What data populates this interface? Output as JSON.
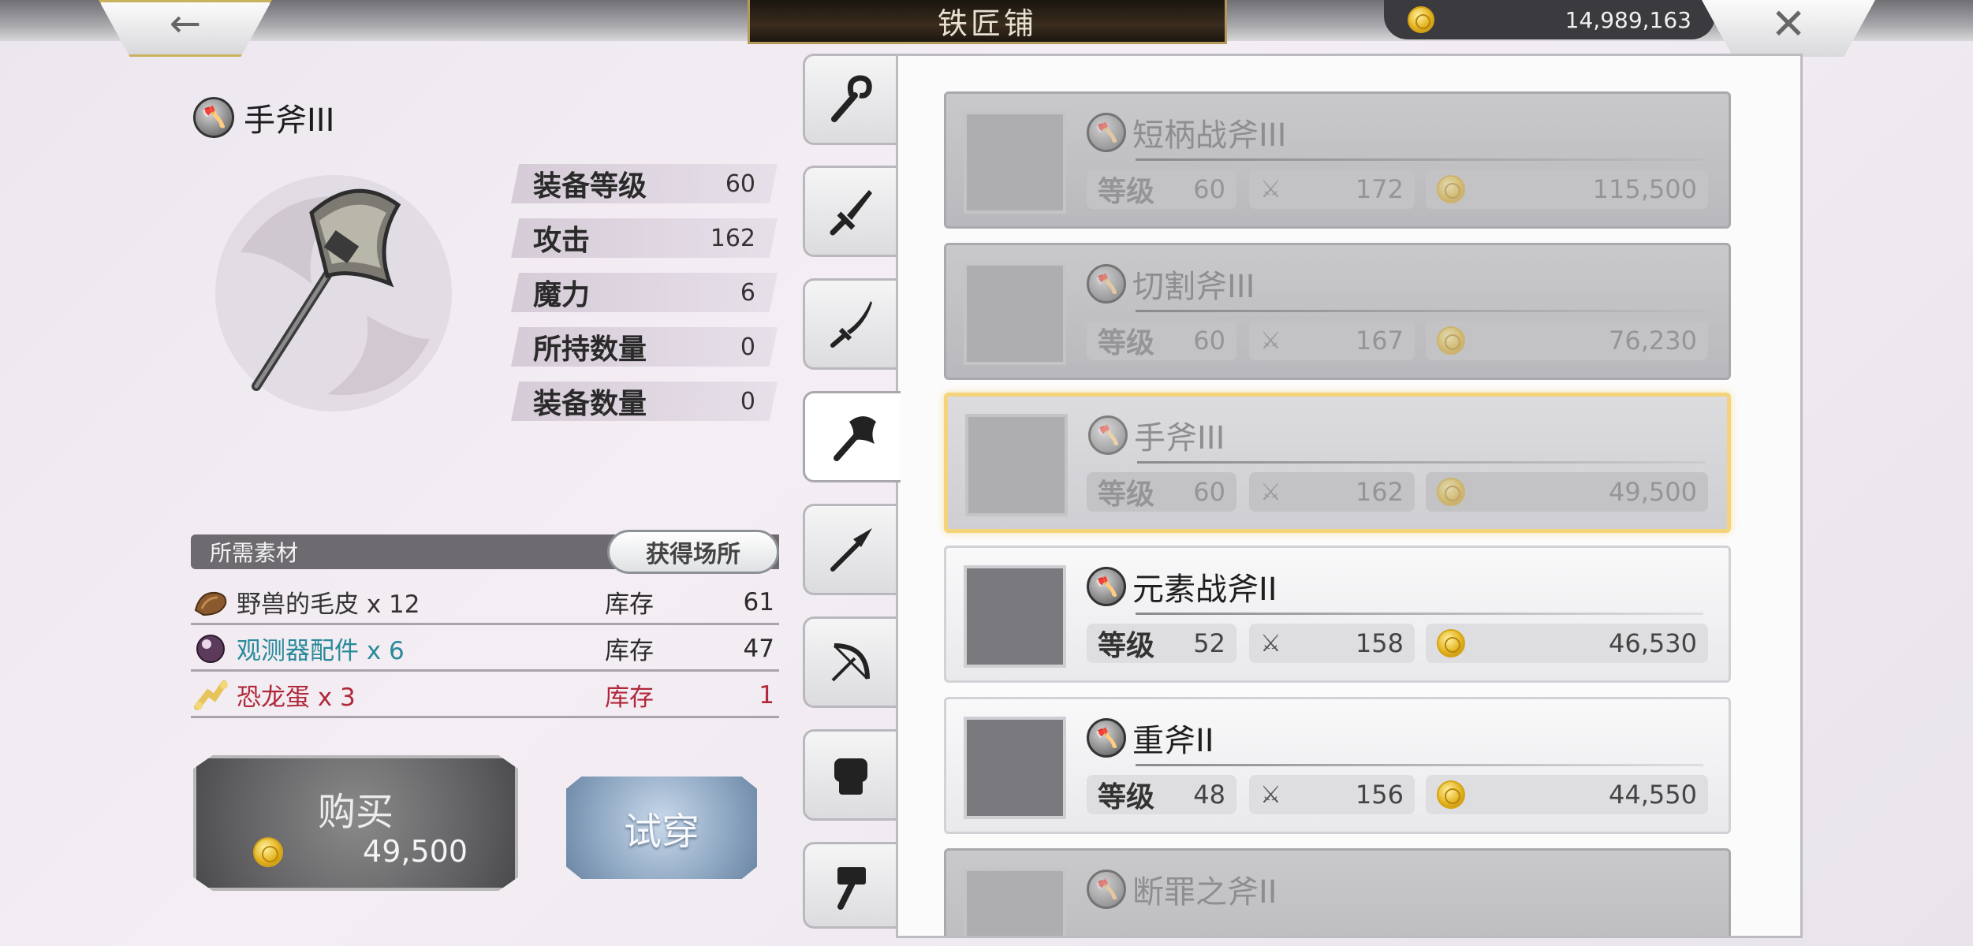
{
  "header": {
    "title": "铁匠铺",
    "currency": "14,989,163",
    "back_icon": "back-arrow-icon",
    "close_icon": "close-icon"
  },
  "item": {
    "name": "手斧III",
    "stats": [
      {
        "label": "装备等级",
        "value": "60"
      },
      {
        "label": "攻击",
        "value": "162"
      },
      {
        "label": "魔力",
        "value": "6"
      },
      {
        "label": "所持数量",
        "value": "0"
      },
      {
        "label": "装备数量",
        "value": "0"
      }
    ]
  },
  "materials": {
    "header": "所需素材",
    "obtain_label": "获得场所",
    "rows": [
      {
        "name": "野兽的毛皮 x 12",
        "stock_label": "库存",
        "stock": "61",
        "color": "#333333"
      },
      {
        "name": "观测器配件 x 6",
        "stock_label": "库存",
        "stock": "47",
        "color": "#2a8a9a"
      },
      {
        "name": "恐龙蛋 x 3",
        "stock_label": "库存",
        "stock": "1",
        "color": "#b0283a"
      }
    ]
  },
  "actions": {
    "buy_label": "购买",
    "buy_price": "49,500",
    "try_label": "试穿"
  },
  "tabs": [
    {
      "icon": "staff-icon"
    },
    {
      "icon": "sword-icon"
    },
    {
      "icon": "katana-icon"
    },
    {
      "icon": "axe-icon",
      "active": true
    },
    {
      "icon": "spear-icon"
    },
    {
      "icon": "bow-icon"
    },
    {
      "icon": "fist-icon"
    },
    {
      "icon": "hammer-icon"
    }
  ],
  "list": [
    {
      "name": "短柄战斧III",
      "level_label": "等级",
      "level": "60",
      "attack": "172",
      "price": "115,500",
      "state": "dim"
    },
    {
      "name": "切割斧III",
      "level_label": "等级",
      "level": "60",
      "attack": "167",
      "price": "76,230",
      "state": "dim"
    },
    {
      "name": "手斧III",
      "level_label": "等级",
      "level": "60",
      "attack": "162",
      "price": "49,500",
      "state": "selected"
    },
    {
      "name": "元素战斧II",
      "level_label": "等级",
      "level": "52",
      "attack": "158",
      "price": "46,530",
      "state": "normal"
    },
    {
      "name": "重斧II",
      "level_label": "等级",
      "level": "48",
      "attack": "156",
      "price": "44,550",
      "state": "normal"
    },
    {
      "name": "断罪之斧II",
      "level_label": "",
      "level": "",
      "attack": "",
      "price": "",
      "state": "dim"
    }
  ]
}
